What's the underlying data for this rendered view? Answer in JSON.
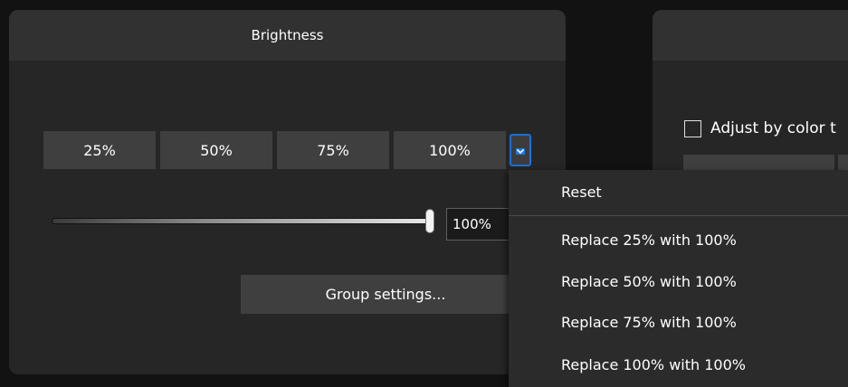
{
  "brightness_panel": {
    "title": "Brightness",
    "presets": [
      "25%",
      "50%",
      "75%",
      "100%"
    ],
    "slider_value": "100%",
    "slider_level": 1.0,
    "group_settings_label": "Group settings..."
  },
  "right_panel": {
    "checkbox_label": "Adjust by color t",
    "checkbox_checked": false
  },
  "dropdown_menu": {
    "items": [
      "Reset",
      "Replace 25% with 100%",
      "Replace 50% with 100%",
      "Replace 75% with 100%",
      "Replace 100% with 100%"
    ]
  },
  "colors": {
    "accent": "#1f7ae0",
    "panel_bg": "#262626",
    "header_bg": "#313131",
    "button_bg": "#3f3f3f",
    "menu_bg": "#2b2b2b"
  }
}
